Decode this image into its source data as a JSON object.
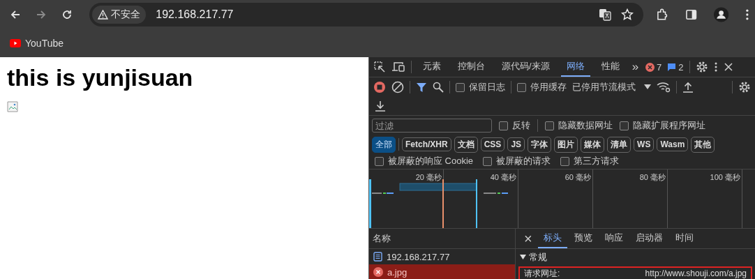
{
  "browser": {
    "nav": [
      {
        "kind": "back",
        "disabled": false
      },
      {
        "kind": "forward",
        "disabled": true
      },
      {
        "kind": "reload",
        "disabled": false
      }
    ],
    "security_label": "不安全",
    "url": "192.168.217.77",
    "bookmarks": [
      {
        "label": "YouTube"
      }
    ]
  },
  "page": {
    "heading": "this is yunjisuan"
  },
  "devtools": {
    "tabs": [
      {
        "label": "元素",
        "selected": false
      },
      {
        "label": "控制台",
        "selected": false
      },
      {
        "label": "源代码/来源",
        "selected": false
      },
      {
        "label": "网络",
        "selected": true
      },
      {
        "label": "性能",
        "selected": false
      }
    ],
    "more": "»",
    "error_count": "7",
    "message_count": "2",
    "recording": true,
    "preserve_log": {
      "label": "保留日志",
      "checked": false
    },
    "disable_cache": {
      "label": "停用缓存",
      "checked": false
    },
    "throttling": "已停用节流模式",
    "filter": {
      "placeholder": "过滤"
    },
    "filter_checks": [
      {
        "label": "反转",
        "checked": false
      },
      {
        "label": "隐藏数据网址",
        "checked": false
      },
      {
        "label": "隐藏扩展程序网址",
        "checked": false
      }
    ],
    "type_filters": [
      {
        "label": "全部",
        "selected": true
      },
      {
        "label": "Fetch/XHR",
        "selected": false
      },
      {
        "label": "文档",
        "selected": false
      },
      {
        "label": "CSS",
        "selected": false
      },
      {
        "label": "JS",
        "selected": false
      },
      {
        "label": "字体",
        "selected": false
      },
      {
        "label": "图片",
        "selected": false
      },
      {
        "label": "媒体",
        "selected": false
      },
      {
        "label": "清单",
        "selected": false
      },
      {
        "label": "WS",
        "selected": false
      },
      {
        "label": "Wasm",
        "selected": false
      },
      {
        "label": "其他",
        "selected": false
      }
    ],
    "request_checks": [
      {
        "label": "被屏蔽的响应 Cookie",
        "checked": false
      },
      {
        "label": "被屏蔽的请求",
        "checked": false
      },
      {
        "label": "第三方请求",
        "checked": false
      }
    ],
    "timeline_ticks": [
      "20 毫秒",
      "40 毫秒",
      "60 毫秒",
      "80 毫秒",
      "100 毫秒"
    ],
    "name_header": "名称",
    "requests": [
      {
        "name": "192.168.217.77",
        "kind": "document",
        "selected": false
      },
      {
        "name": "a.jpg",
        "kind": "error",
        "selected": true
      }
    ],
    "detail_close": "×",
    "detail_tabs": [
      {
        "label": "标头",
        "selected": true
      },
      {
        "label": "预览",
        "selected": false
      },
      {
        "label": "响应",
        "selected": false
      },
      {
        "label": "启动器",
        "selected": false
      },
      {
        "label": "时间",
        "selected": false
      }
    ],
    "section": {
      "label": "常规",
      "expanded": true
    },
    "fields": [
      {
        "label": "请求网址:",
        "value": "http://www.shouji.com/a.jpg"
      }
    ]
  }
}
